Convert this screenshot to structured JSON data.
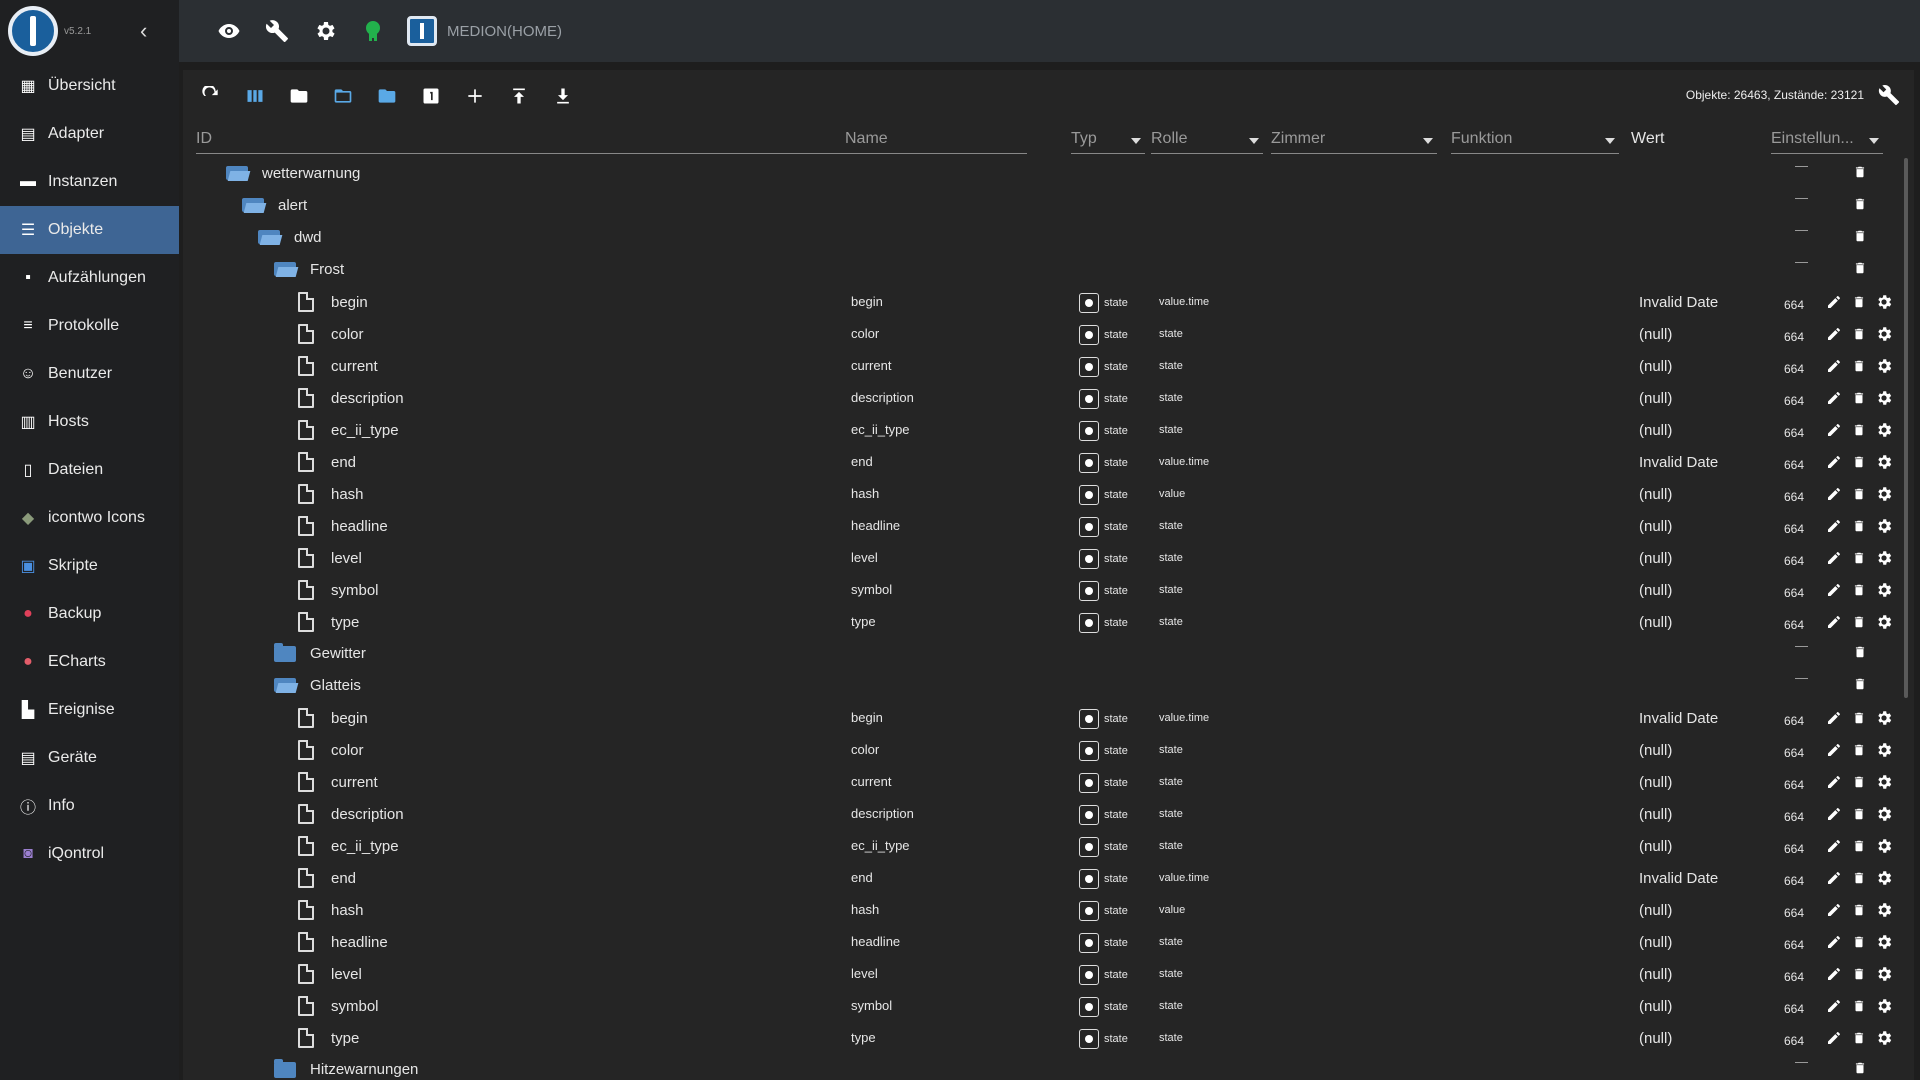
{
  "app": {
    "version": "v5.2.1",
    "host": "MEDION(HOME)"
  },
  "sidebar": {
    "items": [
      {
        "label": "Übersicht",
        "icon": "grid-icon"
      },
      {
        "label": "Adapter",
        "icon": "store-icon"
      },
      {
        "label": "Instanzen",
        "icon": "instances-icon"
      },
      {
        "label": "Objekte",
        "icon": "list-icon",
        "active": true
      },
      {
        "label": "Aufzählungen",
        "icon": "enum-icon"
      },
      {
        "label": "Protokolle",
        "icon": "lines-icon"
      },
      {
        "label": "Benutzer",
        "icon": "user-icon"
      },
      {
        "label": "Hosts",
        "icon": "server-icon"
      },
      {
        "label": "Dateien",
        "icon": "files-icon"
      },
      {
        "label": "icontwo Icons",
        "icon": "icontwo-icon"
      },
      {
        "label": "Skripte",
        "icon": "js-icon"
      },
      {
        "label": "Backup",
        "icon": "backup-icon"
      },
      {
        "label": "ECharts",
        "icon": "echarts-icon"
      },
      {
        "label": "Ereignise",
        "icon": "chart-icon"
      },
      {
        "label": "Geräte",
        "icon": "devices-icon"
      },
      {
        "label": "Info",
        "icon": "info-icon"
      },
      {
        "label": "iQontrol",
        "icon": "iqontrol-icon"
      }
    ]
  },
  "objects": {
    "counts": "Objekte: 26463, Zustände: 23121",
    "columns": {
      "id": "ID",
      "name": "Name",
      "typ": "Typ",
      "rolle": "Rolle",
      "zimmer": "Zimmer",
      "funktion": "Funktion",
      "wert": "Wert",
      "einstellungen": "Einstellun..."
    },
    "folders": [
      {
        "label": "wetterwarnung",
        "open": true,
        "dash": "—"
      },
      {
        "label": "alert",
        "open": true,
        "dash": "—"
      },
      {
        "label": "dwd",
        "open": true,
        "dash": "—"
      },
      {
        "label": "Frost",
        "open": true,
        "dash": "—"
      },
      {
        "label": "Gewitter",
        "open": false,
        "dash": "—"
      },
      {
        "label": "Glatteis",
        "open": true,
        "dash": "—"
      },
      {
        "label": "Hitzewarnungen",
        "open": false,
        "dash": "—"
      }
    ],
    "frost": [
      {
        "id": "begin",
        "name": "begin",
        "typ": "state",
        "rolle": "value.time",
        "wert": "Invalid Date",
        "num": "664"
      },
      {
        "id": "color",
        "name": "color",
        "typ": "state",
        "rolle": "state",
        "wert": "(null)",
        "num": "664"
      },
      {
        "id": "current",
        "name": "current",
        "typ": "state",
        "rolle": "state",
        "wert": "(null)",
        "num": "664"
      },
      {
        "id": "description",
        "name": "description",
        "typ": "state",
        "rolle": "state",
        "wert": "(null)",
        "num": "664"
      },
      {
        "id": "ec_ii_type",
        "name": "ec_ii_type",
        "typ": "state",
        "rolle": "state",
        "wert": "(null)",
        "num": "664"
      },
      {
        "id": "end",
        "name": "end",
        "typ": "state",
        "rolle": "value.time",
        "wert": "Invalid Date",
        "num": "664"
      },
      {
        "id": "hash",
        "name": "hash",
        "typ": "state",
        "rolle": "value",
        "wert": "(null)",
        "num": "664"
      },
      {
        "id": "headline",
        "name": "headline",
        "typ": "state",
        "rolle": "state",
        "wert": "(null)",
        "num": "664"
      },
      {
        "id": "level",
        "name": "level",
        "typ": "state",
        "rolle": "state",
        "wert": "(null)",
        "num": "664"
      },
      {
        "id": "symbol",
        "name": "symbol",
        "typ": "state",
        "rolle": "state",
        "wert": "(null)",
        "num": "664"
      },
      {
        "id": "type",
        "name": "type",
        "typ": "state",
        "rolle": "state",
        "wert": "(null)",
        "num": "664"
      }
    ],
    "glatteis": [
      {
        "id": "begin",
        "name": "begin",
        "typ": "state",
        "rolle": "value.time",
        "wert": "Invalid Date",
        "num": "664"
      },
      {
        "id": "color",
        "name": "color",
        "typ": "state",
        "rolle": "state",
        "wert": "(null)",
        "num": "664"
      },
      {
        "id": "current",
        "name": "current",
        "typ": "state",
        "rolle": "state",
        "wert": "(null)",
        "num": "664"
      },
      {
        "id": "description",
        "name": "description",
        "typ": "state",
        "rolle": "state",
        "wert": "(null)",
        "num": "664"
      },
      {
        "id": "ec_ii_type",
        "name": "ec_ii_type",
        "typ": "state",
        "rolle": "state",
        "wert": "(null)",
        "num": "664"
      },
      {
        "id": "end",
        "name": "end",
        "typ": "state",
        "rolle": "value.time",
        "wert": "Invalid Date",
        "num": "664"
      },
      {
        "id": "hash",
        "name": "hash",
        "typ": "state",
        "rolle": "value",
        "wert": "(null)",
        "num": "664"
      },
      {
        "id": "headline",
        "name": "headline",
        "typ": "state",
        "rolle": "state",
        "wert": "(null)",
        "num": "664"
      },
      {
        "id": "level",
        "name": "level",
        "typ": "state",
        "rolle": "state",
        "wert": "(null)",
        "num": "664"
      },
      {
        "id": "symbol",
        "name": "symbol",
        "typ": "state",
        "rolle": "state",
        "wert": "(null)",
        "num": "664"
      },
      {
        "id": "type",
        "name": "type",
        "typ": "state",
        "rolle": "state",
        "wert": "(null)",
        "num": "664"
      }
    ]
  },
  "colors": {
    "accent": "#3e6594",
    "folder": "#4f86c0",
    "tool_blue": "#5aa9e6",
    "admin_icon": "#22b14c"
  }
}
